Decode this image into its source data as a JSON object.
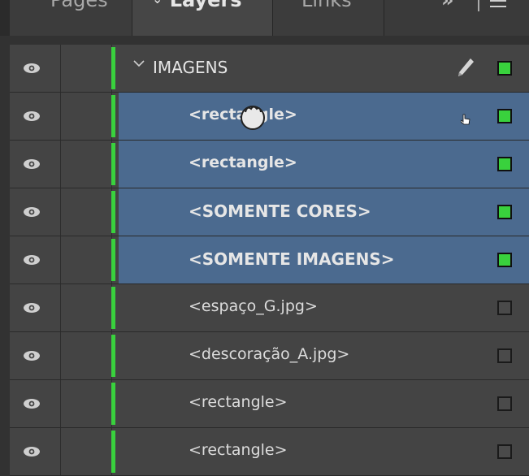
{
  "tabs": {
    "pages": "Pages",
    "layers": "Layers",
    "links": "Links",
    "more": "»"
  },
  "colors": {
    "layer_color": "#39d13d",
    "selection": "#4b6a8f",
    "panel": "#444444"
  },
  "rows": [
    {
      "name": "IMAGENS",
      "type": "layer",
      "expanded": true,
      "selected": false,
      "marker": "filled"
    },
    {
      "name": "<rectangle>",
      "type": "item",
      "selected": true,
      "marker": "filled"
    },
    {
      "name": "<rectangle>",
      "type": "item",
      "selected": true,
      "marker": "filled"
    },
    {
      "name": "<SOMENTE CORES>",
      "type": "item",
      "selected": true,
      "marker": "filled"
    },
    {
      "name": "<SOMENTE IMAGENS>",
      "type": "item",
      "selected": true,
      "marker": "filled"
    },
    {
      "name": "<espaço_G.jpg>",
      "type": "item",
      "selected": false,
      "marker": "empty"
    },
    {
      "name": "<descoração_A.jpg>",
      "type": "item",
      "selected": false,
      "marker": "empty"
    },
    {
      "name": "<rectangle>",
      "type": "item",
      "selected": false,
      "marker": "empty"
    },
    {
      "name": "<rectangle>",
      "type": "item",
      "selected": false,
      "marker": "empty"
    }
  ],
  "icons": {
    "visibility": "eye-icon",
    "expand": "chevron-down-icon",
    "edit": "pen-icon",
    "cursor": "grab-hand-cursor-icon"
  }
}
